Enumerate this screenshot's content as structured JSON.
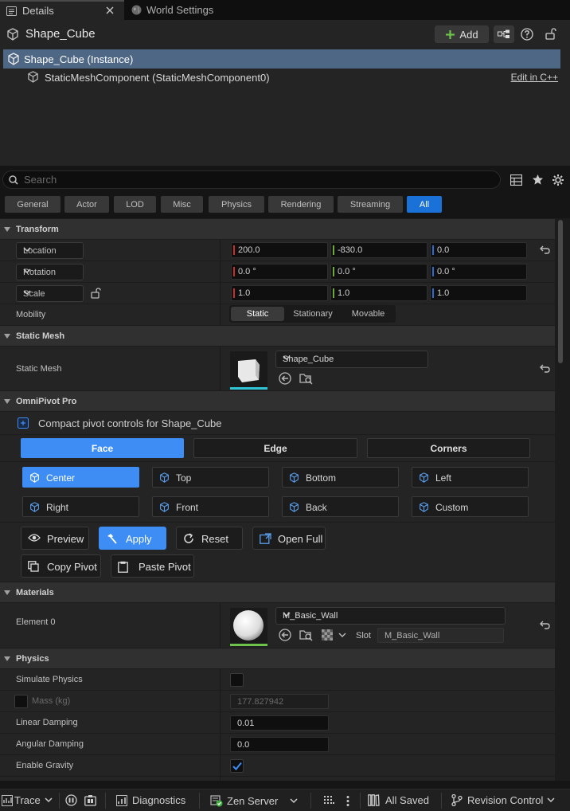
{
  "tabs": [
    {
      "label": "Details",
      "active": true
    },
    {
      "label": "World Settings",
      "active": false
    }
  ],
  "header": {
    "actor_name": "Shape_Cube",
    "add_label": "Add"
  },
  "component_tree": {
    "instance_label": "Shape_Cube (Instance)",
    "component_label": "StaticMeshComponent (StaticMeshComponent0)",
    "edit_link": "Edit in C++"
  },
  "search": {
    "placeholder": "Search"
  },
  "filters": [
    "General",
    "Actor",
    "LOD",
    "Misc",
    "Physics",
    "Rendering",
    "Streaming",
    "All"
  ],
  "filters_active": "All",
  "transform": {
    "section": "Transform",
    "location_label": "Location",
    "location": [
      "200.0",
      "-830.0",
      "0.0"
    ],
    "rotation_label": "Rotation",
    "rotation": [
      "0.0 °",
      "0.0 °",
      "0.0 °"
    ],
    "scale_label": "Scale",
    "scale": [
      "1.0",
      "1.0",
      "1.0"
    ],
    "mobility_label": "Mobility",
    "mobility_options": [
      "Static",
      "Stationary",
      "Movable"
    ],
    "mobility_selected": "Static"
  },
  "static_mesh": {
    "section": "Static Mesh",
    "label": "Static Mesh",
    "asset": "Shape_Cube"
  },
  "omnipivot": {
    "section": "OmniPivot Pro",
    "description": "Compact pivot controls for Shape_Cube",
    "modes": [
      "Face",
      "Edge",
      "Corners"
    ],
    "mode_selected": "Face",
    "pivots": [
      "Center",
      "Top",
      "Bottom",
      "Left",
      "Right",
      "Front",
      "Back",
      "Custom"
    ],
    "pivot_selected": "Center",
    "actions": {
      "preview": "Preview",
      "apply": "Apply",
      "reset": "Reset",
      "open_full": "Open Full",
      "copy": "Copy Pivot",
      "paste": "Paste Pivot"
    }
  },
  "materials": {
    "section": "Materials",
    "element_label": "Element 0",
    "material": "M_Basic_Wall",
    "slot_label": "Slot",
    "slot_value": "M_Basic_Wall"
  },
  "physics": {
    "section": "Physics",
    "simulate_label": "Simulate Physics",
    "simulate_checked": false,
    "mass_label": "Mass (kg)",
    "mass_value": "177.827942",
    "linear_label": "Linear Damping",
    "linear_value": "0.01",
    "angular_label": "Angular Damping",
    "angular_value": "0.0",
    "gravity_label": "Enable Gravity",
    "gravity_checked": true
  },
  "statusbar": {
    "trace": "Trace",
    "diagnostics": "Diagnostics",
    "zen": "Zen Server",
    "saved": "All Saved",
    "revision": "Revision Control"
  },
  "colors": {
    "accent": "#3d8df5",
    "selection_row": "#4e6785",
    "axis_x": "#c8302b",
    "axis_y": "#6ca83a",
    "axis_z": "#2f6ad4",
    "add_icon": "#6cc24a"
  }
}
